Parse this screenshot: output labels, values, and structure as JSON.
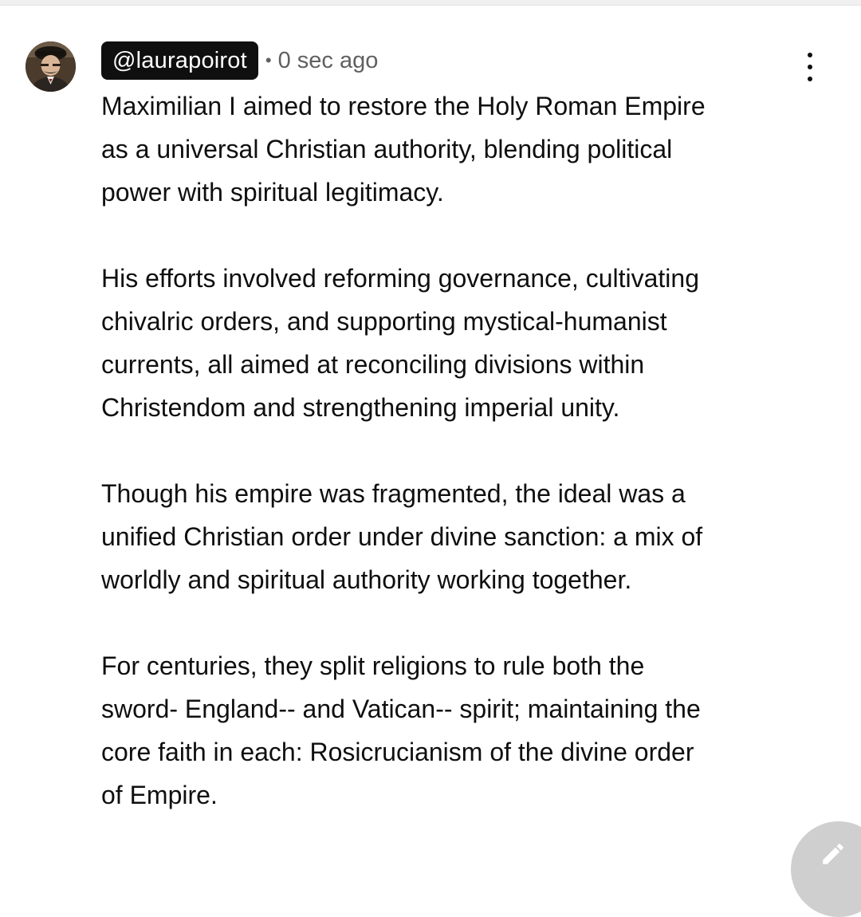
{
  "comment": {
    "author_handle": "@laurapoirot",
    "separator": "•",
    "timestamp": "0 sec ago",
    "avatar_icon": "user-avatar-photo",
    "menu_icon": "more-vert-icon",
    "paragraphs": [
      [
        "Maximilian I aimed to restore the Holy Roman Empire",
        "as a universal Christian authority, blending political",
        "power with spiritual legitimacy."
      ],
      [
        "His efforts involved reforming governance, cultivating",
        "chivalric orders, and supporting mystical-humanist",
        "currents, all aimed at reconciling divisions within",
        "Christendom and strengthening imperial unity."
      ],
      [
        "Though his empire was fragmented, the ideal was a",
        "unified Christian order under divine sanction: a mix of",
        "worldly and spiritual authority working together."
      ],
      [
        "For centuries, they split religions to rule both the",
        "sword- England-- and Vatican-- spirit; maintaining the",
        "core faith in each: Rosicrucianism of the divine order",
        "of Empire."
      ]
    ]
  },
  "fab": {
    "icon": "edit-pencil-icon",
    "color": "#cfcfcf"
  },
  "colors": {
    "handle_bg": "#0f0f0f",
    "handle_text": "#ffffff",
    "meta_text": "#606060",
    "body_text": "#0f0f0f"
  }
}
